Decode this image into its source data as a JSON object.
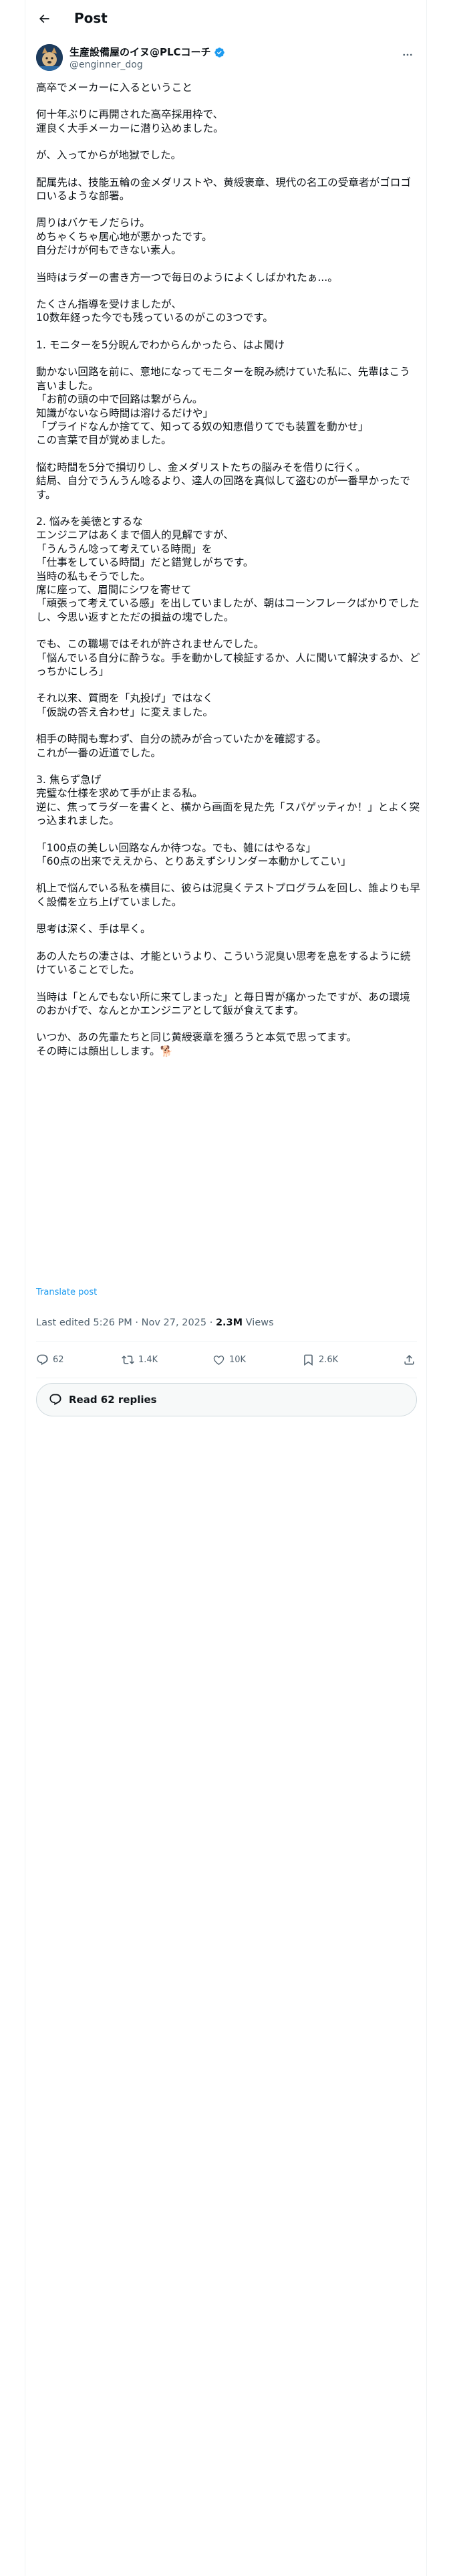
{
  "header": {
    "title": "Post"
  },
  "author": {
    "display_name": "生産設備屋のイヌ@PLCコーチ",
    "handle": "@enginner_dog"
  },
  "post": {
    "paragraphs": [
      "高卒でメーカーに入るということ",
      "何十年ぶりに再開された高卒採用枠で、\n運良く大手メーカーに潜り込めました。",
      "が、入ってからが地獄でした。",
      "配属先は、技能五輪の金メダリストや、黄綬褒章、現代の名工の受章者がゴロゴロいるような部署。",
      "周りはバケモノだらけ。\nめちゃくちゃ居心地が悪かったです。\n自分だけが何もできない素人。",
      "当時はラダーの書き方一つで毎日のようによくしばかれたぁ...。",
      "たくさん指導を受けましたが、\n10数年経った今でも残っているのがこの3つです。",
      "1. モニターを5分睨んでわからんかったら、はよ聞け",
      "動かない回路を前に、意地になってモニターを睨み続けていた私に、先輩はこう言いました。\n「お前の頭の中で回路は繋がらん。\n知識がないなら時間は溶けるだけや」\n「プライドなんか捨てて、知ってる奴の知恵借りてでも装置を動かせ」\nこの言葉で目が覚めました。",
      "悩む時間を5分で損切りし、金メダリストたちの脳みそを借りに行く。\n結局、自分でうんうん唸るより、達人の回路を真似して盗むのが一番早かったです。",
      "2. 悩みを美徳とするな\nエンジニアはあくまで個人的見解ですが、\n「うんうん唸って考えている時間」を\n「仕事をしている時間」だと錯覚しがちです。\n当時の私もそうでした。\n席に座って、眉間にシワを寄せて\n「頑張って考えている感」を出していましたが、朝はコーンフレークばかりでしたし、今思い返すとただの損益の塊でした。",
      "でも、この職場ではそれが許されませんでした。\n「悩んでいる自分に酔うな。手を動かして検証するか、人に聞いて解決するか、どっちかにしろ」",
      "それ以来、質問を「丸投げ」ではなく\n「仮説の答え合わせ」に変えました。",
      "相手の時間も奪わず、自分の読みが合っていたかを確認する。\nこれが一番の近道でした。",
      "3. 焦らず急げ\n完璧な仕様を求めて手が止まる私。\n逆に、焦ってラダーを書くと、横から画面を見た先「スパゲッティか！」とよく突っ込まれました。",
      "「100点の美しい回路なんか待つな。でも、雑にはやるな」\n「60点の出来でええから、とりあえずシリンダー本動かしてこい」",
      "机上で悩んでいる私を横目に、彼らは泥臭くテストプログラムを回し、誰よりも早く設備を立ち上げていました。",
      "思考は深く、手は早く。",
      "あの人たちの凄さは、才能というより、こういう泥臭い思考を息をするように続けていることでした。",
      "当時は「とんでもない所に来てしまった」と毎日胃が痛かったですが、あの環境のおかげで、なんとかエンジニアとして飯が食えてます。",
      "いつか、あの先輩たちと同じ黄綬褒章を獲ろうと本気で思ってます。\nその時には顔出しします。🐕"
    ],
    "translate_label": "Translate post",
    "edited_label": "Last edited 5:26 PM · Nov 27, 2025 · ",
    "views_count": "2.3M",
    "views_label": " Views"
  },
  "actions": {
    "replies": "62",
    "reposts": "1.4K",
    "likes": "10K",
    "bookmarks": "2.6K"
  },
  "read_replies_label": "Read 62 replies",
  "colors": {
    "accent": "#1d9bf0",
    "secondary_text": "#536471",
    "border": "#eff3f4"
  }
}
